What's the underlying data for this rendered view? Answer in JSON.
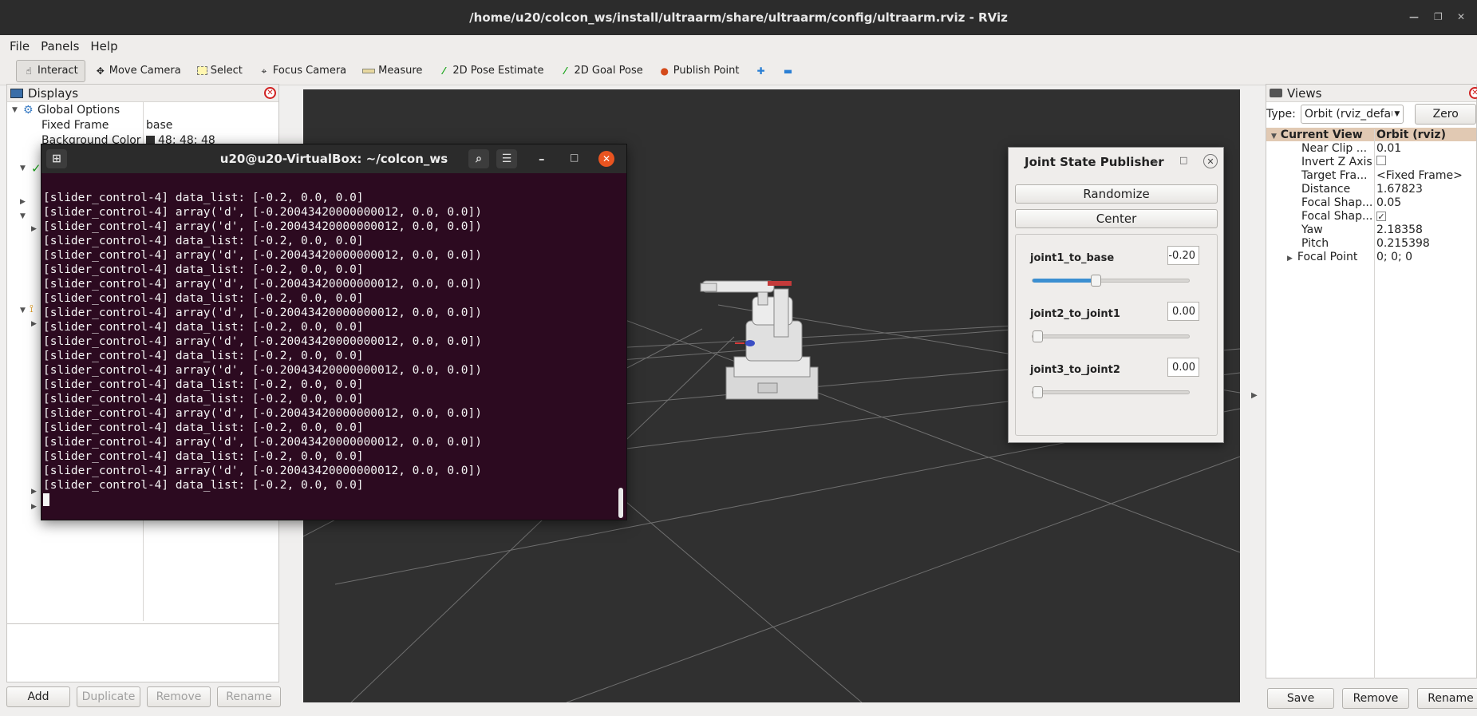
{
  "window": {
    "title": "/home/u20/colcon_ws/install/ultraarm/share/ultraarm/config/ultraarm.rviz - RViz"
  },
  "menu": [
    "File",
    "Panels",
    "Help"
  ],
  "toolbar": {
    "interact": "Interact",
    "move_camera": "Move Camera",
    "select": "Select",
    "focus_camera": "Focus Camera",
    "measure": "Measure",
    "pose_estimate": "2D Pose Estimate",
    "goal_pose": "2D Goal Pose",
    "publish_point": "Publish Point"
  },
  "displays": {
    "title": "Displays",
    "global_options": "Global Options",
    "fixed_frame_label": "Fixed Frame",
    "fixed_frame_value": "base",
    "bg_color_label": "Background Color",
    "bg_color_value": "48; 48; 48",
    "buttons": {
      "add": "Add",
      "duplicate": "Duplicate",
      "remove": "Remove",
      "rename": "Rename"
    }
  },
  "views": {
    "title": "Views",
    "type_label": "Type:",
    "type_value": "Orbit (rviz_defau",
    "zero": "Zero",
    "current_view": "Current View",
    "current_view_value": "Orbit (rviz)",
    "rows": [
      {
        "k": "Near Clip ...",
        "v": "0.01"
      },
      {
        "k": "Invert Z Axis",
        "v": ""
      },
      {
        "k": "Target Fra...",
        "v": "<Fixed Frame>"
      },
      {
        "k": "Distance",
        "v": "1.67823"
      },
      {
        "k": "Focal Shap...",
        "v": "0.05"
      },
      {
        "k": "Focal Shap...",
        "v": ""
      },
      {
        "k": "Yaw",
        "v": "2.18358"
      },
      {
        "k": "Pitch",
        "v": "0.215398"
      },
      {
        "k": "Focal Point",
        "v": "0; 0; 0"
      }
    ],
    "invert_z_checked": false,
    "focal_shape_checked": true,
    "buttons": {
      "save": "Save",
      "remove": "Remove",
      "rename": "Rename"
    }
  },
  "terminal": {
    "title": "u20@u20-VirtualBox: ~/colcon_ws",
    "lines": [
      "[slider_control-4] data_list: [-0.2, 0.0, 0.0]",
      "[slider_control-4] array('d', [-0.20043420000000012, 0.0, 0.0])",
      "[slider_control-4] array('d', [-0.20043420000000012, 0.0, 0.0])",
      "[slider_control-4] data_list: [-0.2, 0.0, 0.0]",
      "[slider_control-4] array('d', [-0.20043420000000012, 0.0, 0.0])",
      "[slider_control-4] data_list: [-0.2, 0.0, 0.0]",
      "[slider_control-4] array('d', [-0.20043420000000012, 0.0, 0.0])",
      "[slider_control-4] data_list: [-0.2, 0.0, 0.0]",
      "[slider_control-4] array('d', [-0.20043420000000012, 0.0, 0.0])",
      "[slider_control-4] data_list: [-0.2, 0.0, 0.0]",
      "[slider_control-4] array('d', [-0.20043420000000012, 0.0, 0.0])",
      "[slider_control-4] data_list: [-0.2, 0.0, 0.0]",
      "[slider_control-4] array('d', [-0.20043420000000012, 0.0, 0.0])",
      "[slider_control-4] data_list: [-0.2, 0.0, 0.0]",
      "[slider_control-4] data_list: [-0.2, 0.0, 0.0]",
      "[slider_control-4] array('d', [-0.20043420000000012, 0.0, 0.0])",
      "[slider_control-4] data_list: [-0.2, 0.0, 0.0]",
      "[slider_control-4] array('d', [-0.20043420000000012, 0.0, 0.0])",
      "[slider_control-4] data_list: [-0.2, 0.0, 0.0]",
      "[slider_control-4] array('d', [-0.20043420000000012, 0.0, 0.0])",
      "[slider_control-4] data_list: [-0.2, 0.0, 0.0]"
    ]
  },
  "jsp": {
    "title": "Joint State Publisher",
    "randomize": "Randomize",
    "center": "Center",
    "joints": [
      {
        "name": "joint1_to_base",
        "value": "-0.20",
        "fraction": 0.4
      },
      {
        "name": "joint2_to_joint1",
        "value": "0.00",
        "fraction": 0.0
      },
      {
        "name": "joint3_to_joint2",
        "value": "0.00",
        "fraction": 0.0
      }
    ]
  },
  "colors": {
    "viewport_bg": "#303030",
    "terminal_bg": "#2c0a20",
    "close_red": "#e95420",
    "slider_blue": "#3b8fd1"
  }
}
